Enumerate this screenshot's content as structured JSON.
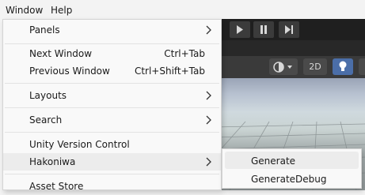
{
  "menubar": {
    "items": [
      {
        "label": "Window"
      },
      {
        "label": "Help"
      }
    ]
  },
  "toolbar": {
    "play_icon": "play-icon",
    "pause_icon": "pause-icon",
    "step_icon": "step-icon"
  },
  "scene_toolbar": {
    "shading_icon": "shading-mode-icon",
    "mode_2d_label": "2D",
    "lighting_icon": "lightbulb-icon"
  },
  "window_menu": {
    "items": [
      {
        "label": "Panels",
        "shortcut": "",
        "submenu": true
      },
      {
        "label": "Next Window",
        "shortcut": "Ctrl+Tab",
        "submenu": false
      },
      {
        "label": "Previous Window",
        "shortcut": "Ctrl+Shift+Tab",
        "submenu": false
      },
      {
        "label": "Layouts",
        "shortcut": "",
        "submenu": true
      },
      {
        "label": "Search",
        "shortcut": "",
        "submenu": true
      },
      {
        "label": "Unity Version Control",
        "shortcut": "",
        "submenu": false
      },
      {
        "label": "Hakoniwa",
        "shortcut": "",
        "submenu": true,
        "highlighted": true
      },
      {
        "label": "Asset Store",
        "shortcut": "",
        "submenu": false
      }
    ]
  },
  "hakoniwa_submenu": {
    "items": [
      {
        "label": "Generate",
        "highlighted": true
      },
      {
        "label": "GenerateDebug"
      }
    ]
  },
  "colors": {
    "menu_bg": "#f9f9f9",
    "highlight": "#ececec",
    "editor_dark": "#1f1f1f",
    "active_toggle": "#4b6ea8"
  }
}
